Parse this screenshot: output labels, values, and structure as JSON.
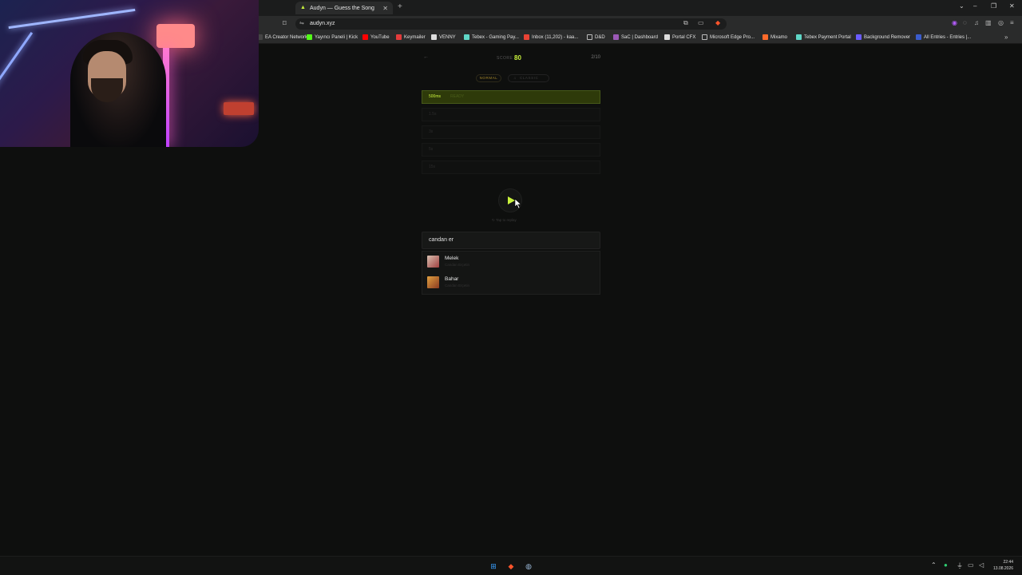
{
  "browser": {
    "tab_title": "Audyn — Guess the Song",
    "new_tab": "+",
    "url": "audyn.xyz",
    "bookmarks": [
      {
        "label": "EA Creator Network",
        "icon": "ea-icon",
        "color": "#444444"
      },
      {
        "label": "Yayıncı Paneli | Kick",
        "icon": "kick-icon",
        "color": "#53fc18"
      },
      {
        "label": "YouTube",
        "icon": "youtube-icon",
        "color": "#ff0000"
      },
      {
        "label": "Keymailer",
        "icon": "keymailer-icon",
        "color": "#e33b3b"
      },
      {
        "label": "VENNY",
        "icon": "venny-icon",
        "color": "#dddddd"
      },
      {
        "label": "Tebex - Gaming Pay...",
        "icon": "tebex-icon",
        "color": "#5fd6c6"
      },
      {
        "label": "Inbox (11,202) - kaa...",
        "icon": "gmail-icon",
        "color": "#ea4335"
      },
      {
        "label": "D&D",
        "icon": "folder-icon",
        "color": "#bbbbbb"
      },
      {
        "label": "SaC | Dashboard",
        "icon": "sac-icon",
        "color": "#9b59b6"
      },
      {
        "label": "Portal CFX",
        "icon": "cfx-icon",
        "color": "#dddddd"
      },
      {
        "label": "Microsoft Edge Pro...",
        "icon": "folder-icon",
        "color": "#bbbbbb"
      },
      {
        "label": "Mixamo",
        "icon": "mixamo-icon",
        "color": "#ff6a2a"
      },
      {
        "label": "Tebex Payment Portal",
        "icon": "tebex-icon",
        "color": "#5fd6c6"
      },
      {
        "label": "Background Remover",
        "icon": "bg-remover-icon",
        "color": "#6a5cff"
      },
      {
        "label": "All Entries - Entries |...",
        "icon": "entries-icon",
        "color": "#3a5ccc"
      }
    ]
  },
  "game": {
    "score_label": "SCORE",
    "score": "80",
    "round": "2/10",
    "modes": {
      "normal": "NORMAL",
      "classic": "CLASSIC"
    },
    "slots": [
      {
        "label": "500ms",
        "status": "READY"
      },
      {
        "label": "1.5s"
      },
      {
        "label": "3s"
      },
      {
        "label": "5s"
      },
      {
        "label": "15s"
      }
    ],
    "hint": "Tap to replay",
    "search_value": "candan er",
    "results": [
      {
        "title": "Melek",
        "artist": "Candan Erçetin"
      },
      {
        "title": "Bahar",
        "artist": "Candan Erçetin"
      }
    ],
    "accent": "#c9f23c"
  },
  "system": {
    "time": "22:44",
    "date": "13.08.2026"
  }
}
